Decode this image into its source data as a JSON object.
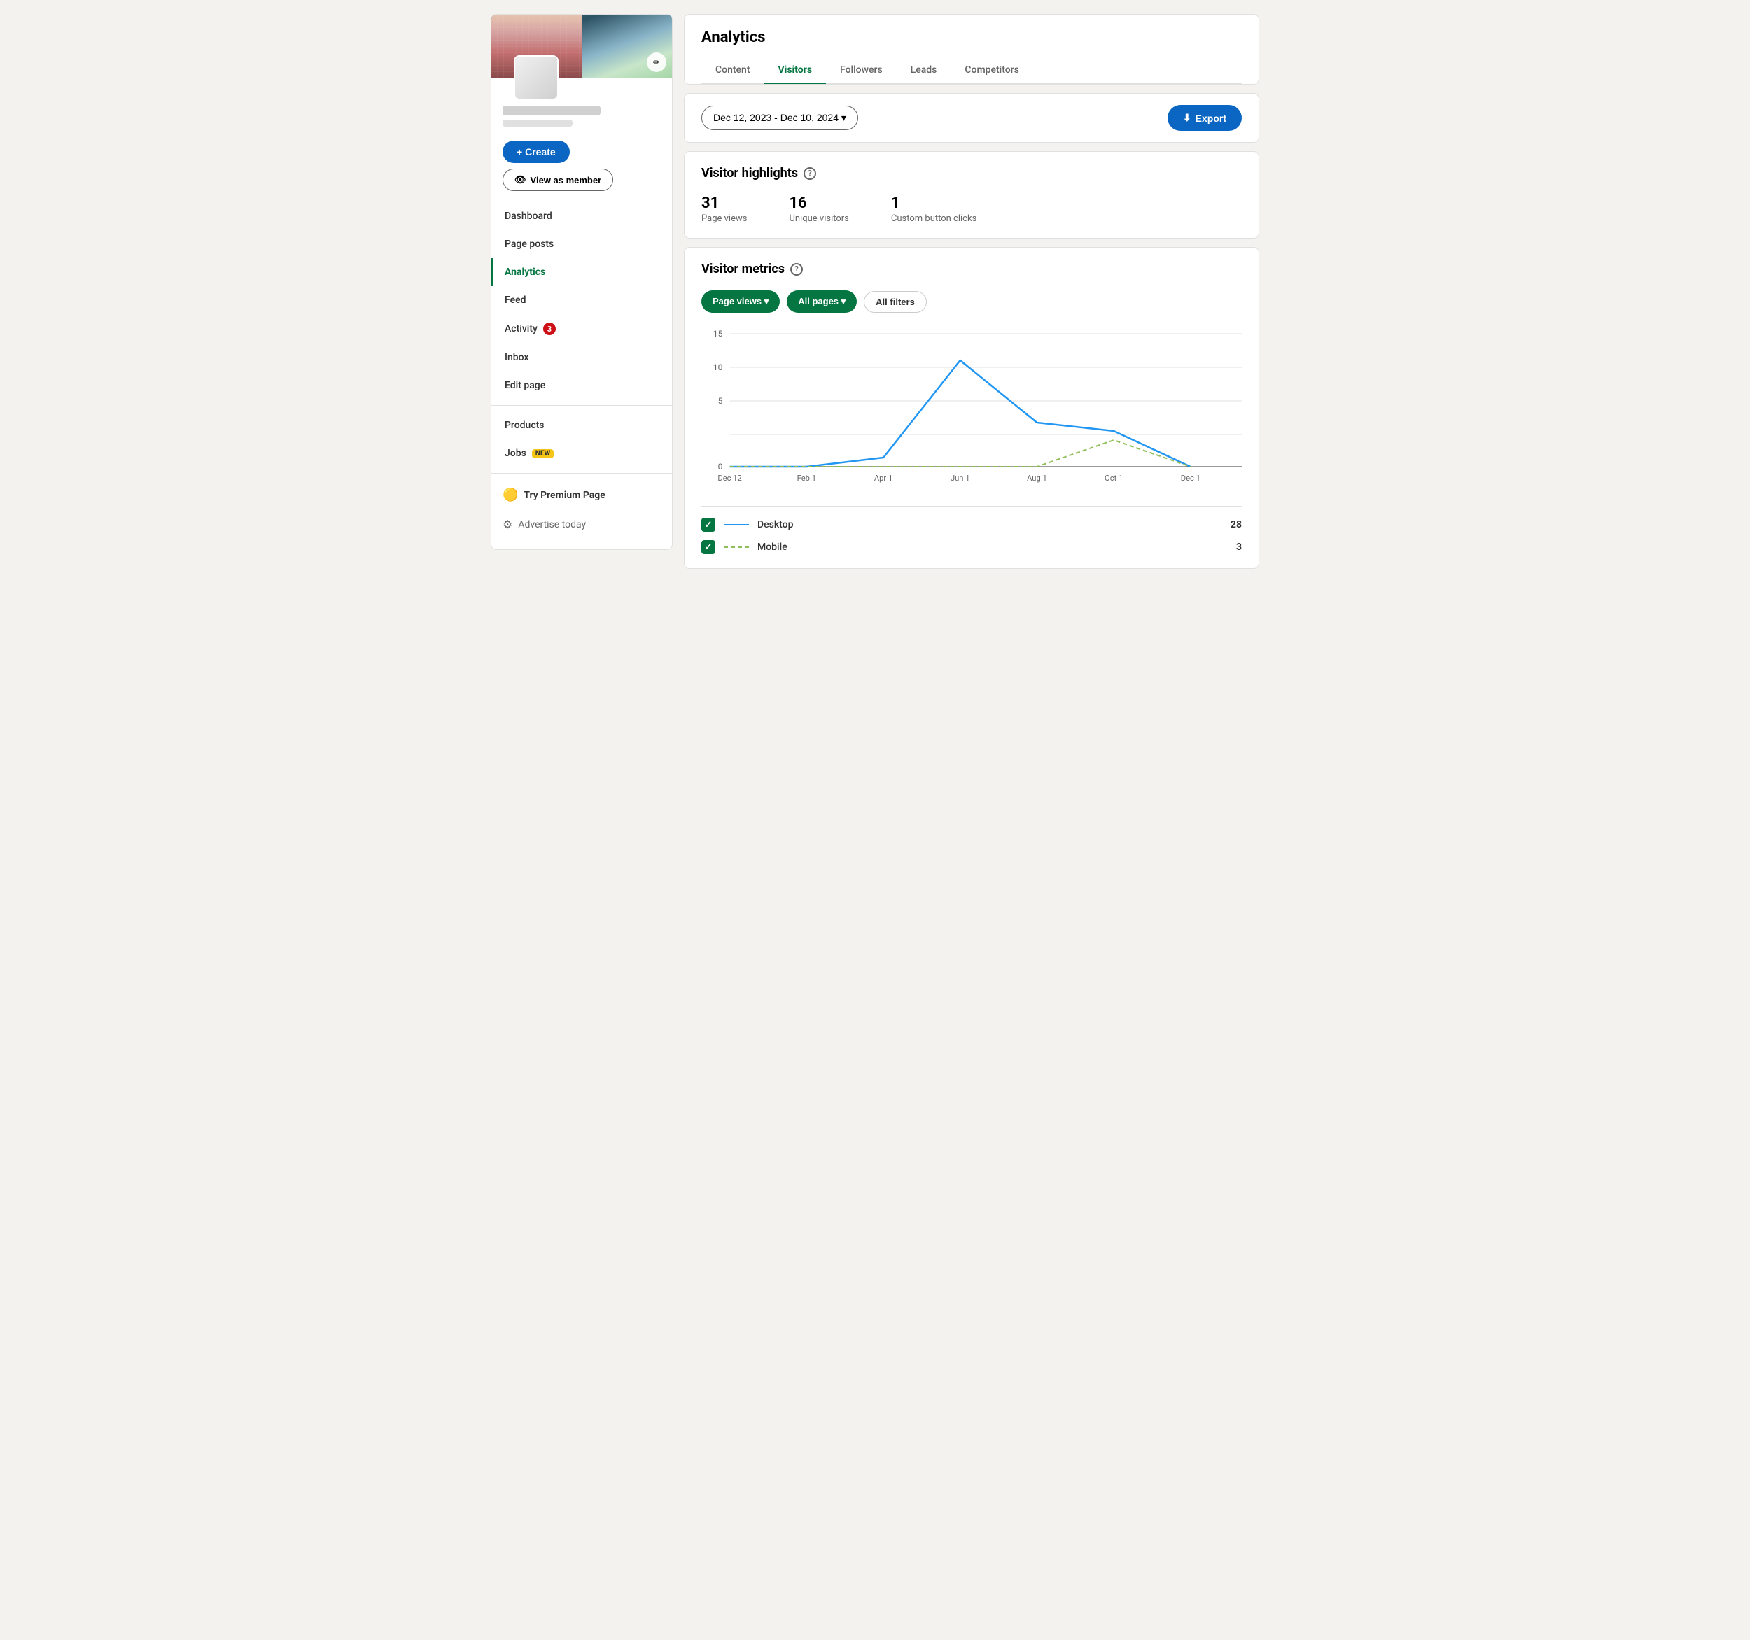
{
  "sidebar": {
    "edit_cover_icon": "✏",
    "buttons": {
      "create": "+ Create",
      "view_as_member": "View as member"
    },
    "nav_items": [
      {
        "id": "dashboard",
        "label": "Dashboard",
        "active": false,
        "badge": null
      },
      {
        "id": "page-posts",
        "label": "Page posts",
        "active": false,
        "badge": null
      },
      {
        "id": "analytics",
        "label": "Analytics",
        "active": true,
        "badge": null
      },
      {
        "id": "feed",
        "label": "Feed",
        "active": false,
        "badge": null
      },
      {
        "id": "activity",
        "label": "Activity",
        "active": false,
        "badge": "3"
      },
      {
        "id": "inbox",
        "label": "Inbox",
        "active": false,
        "badge": null
      },
      {
        "id": "edit-page",
        "label": "Edit page",
        "active": false,
        "badge": null
      }
    ],
    "nav_items2": [
      {
        "id": "products",
        "label": "Products",
        "active": false,
        "badge": null
      },
      {
        "id": "jobs",
        "label": "Jobs",
        "active": false,
        "badge": "NEW"
      }
    ],
    "premium": {
      "icon": "🟡",
      "label": "Try Premium Page"
    },
    "advertise": {
      "label": "Advertise today"
    }
  },
  "main": {
    "analytics_title": "Analytics",
    "tabs": [
      {
        "id": "content",
        "label": "Content",
        "active": false
      },
      {
        "id": "visitors",
        "label": "Visitors",
        "active": true
      },
      {
        "id": "followers",
        "label": "Followers",
        "active": false
      },
      {
        "id": "leads",
        "label": "Leads",
        "active": false
      },
      {
        "id": "competitors",
        "label": "Competitors",
        "active": false
      }
    ],
    "date_range": "Dec 12, 2023 - Dec 10, 2024 ▾",
    "export_label": "Export",
    "visitor_highlights": {
      "title": "Visitor highlights",
      "stats": [
        {
          "number": "31",
          "label": "Page views"
        },
        {
          "number": "16",
          "label": "Unique visitors"
        },
        {
          "number": "1",
          "label": "Custom button clicks"
        }
      ]
    },
    "visitor_metrics": {
      "title": "Visitor metrics",
      "filters": {
        "page_views": "Page views ▾",
        "all_pages": "All pages ▾",
        "all_filters": "All filters"
      },
      "chart": {
        "x_labels": [
          "Dec 12",
          "Feb 1",
          "Apr 1",
          "Jun 1",
          "Aug 1",
          "Oct 1",
          "Dec 1"
        ],
        "y_labels": [
          "15",
          "10",
          "5",
          "0"
        ],
        "desktop_data": [
          0,
          0,
          1,
          12,
          5,
          4,
          0
        ],
        "mobile_data": [
          0,
          0,
          0,
          0,
          0,
          3,
          0
        ]
      },
      "legend": [
        {
          "type": "desktop",
          "label": "Desktop",
          "value": "28"
        },
        {
          "type": "mobile",
          "label": "Mobile",
          "value": "3"
        }
      ]
    }
  }
}
